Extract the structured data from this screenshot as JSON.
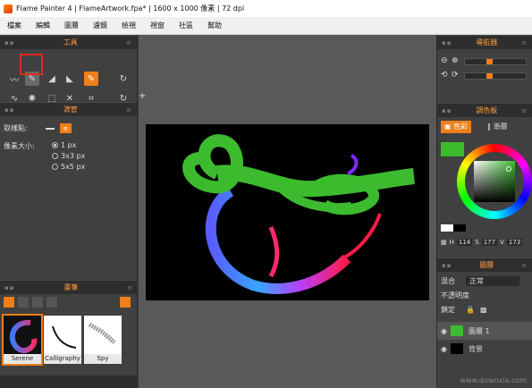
{
  "window": {
    "title": "Flame Painter 4 | FlameArtwork.fpa* | 1600 x 1000 像素 | 72 dpi"
  },
  "menu": [
    "檔案",
    "編輯",
    "圖層",
    "濾鏡",
    "檢視",
    "視窗",
    "社區",
    "幫助"
  ],
  "tools_panel": {
    "title": "工具"
  },
  "dropper_panel": {
    "title": "滴管",
    "sample_label": "取樣點:",
    "size_label": "像素大小:",
    "options": [
      "1 px",
      "3x3 px",
      "5x5 px"
    ],
    "selected": "1 px"
  },
  "brushes_panel": {
    "title": "畫筆",
    "items": [
      "Serene",
      "Calligraphy",
      "Spy"
    ]
  },
  "navigator_panel": {
    "title": "導航器"
  },
  "palette_panel": {
    "title": "調色板",
    "tabs": [
      "色彩",
      "漸層"
    ],
    "hsv": {
      "h_label": "H",
      "h": "114",
      "s_label": "S",
      "s": "177",
      "v_label": "V",
      "v": "173"
    },
    "current_color": "#3dbb2f"
  },
  "layers_panel": {
    "title": "圖層",
    "blend_label": "混合",
    "blend_value": "正常",
    "opacity_label": "不透明度",
    "lock_label": "鎖定",
    "layers": [
      "圖層 1",
      "背景"
    ]
  },
  "watermark": "www.downxia.com",
  "colors": {
    "accent": "#ef7f1a",
    "panel": "#404040",
    "header": "#2e2e2e",
    "workspace": "#595959"
  }
}
